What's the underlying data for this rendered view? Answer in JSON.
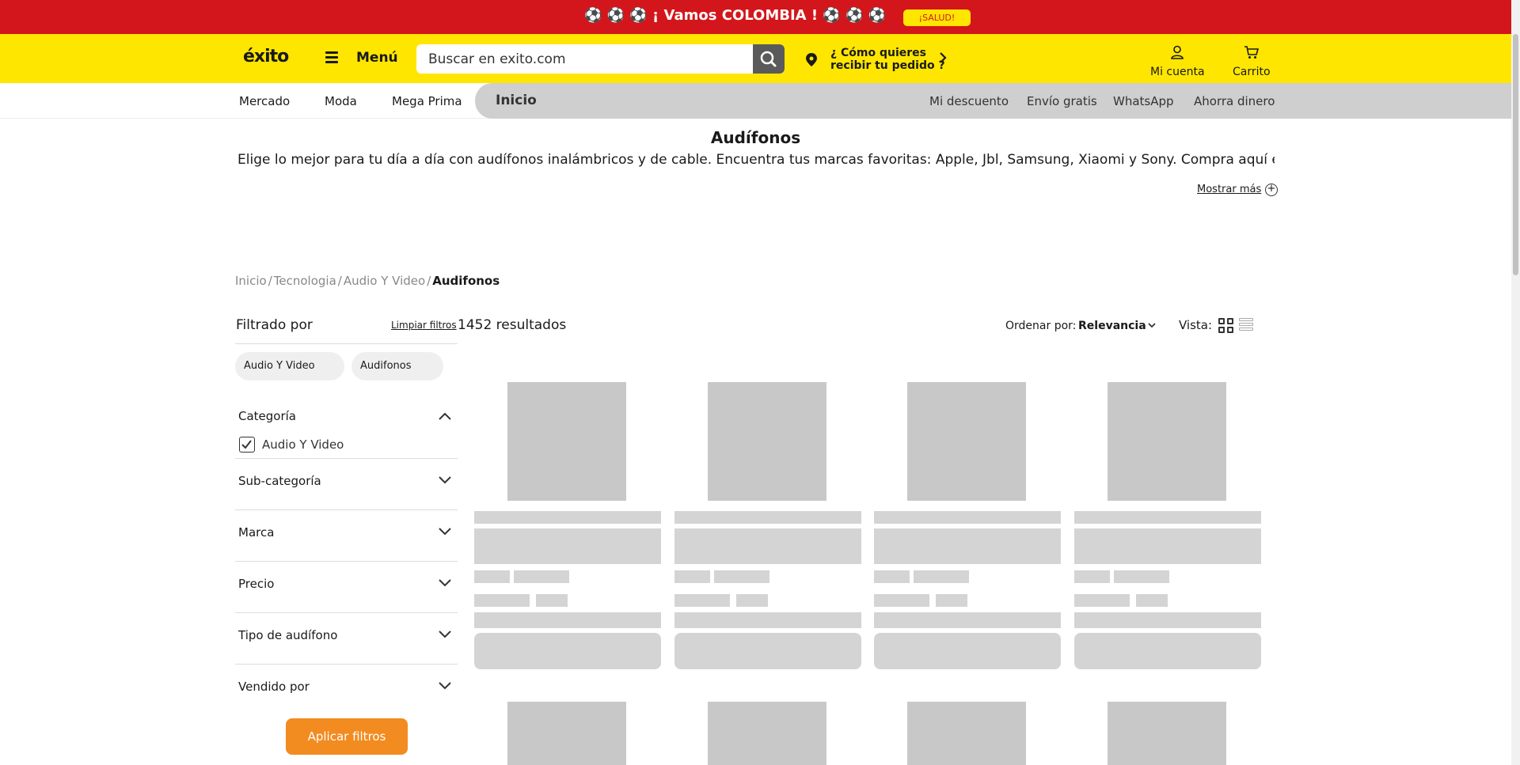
{
  "promo": {
    "text": "⚽ ⚽ ⚽ ¡ Vamos COLOMBIA ! ⚽ ⚽ ⚽",
    "button": "¡SALUD!"
  },
  "header": {
    "logo": "éxito",
    "menu_label": "Menú",
    "search_placeholder": "Buscar en exito.com",
    "location_line1": "¿ Cómo quieres",
    "location_line2": "recibir tu pedido ?",
    "account_label": "Mi cuenta",
    "cart_label": "Carrito"
  },
  "nav": {
    "left": [
      "Mercado",
      "Moda",
      "Mega Prima"
    ],
    "inicio": "Inicio",
    "right": [
      "Mi descuento",
      "Envío gratis",
      "WhatsApp",
      "Ahorra dinero"
    ]
  },
  "category": {
    "title": "Audífonos",
    "description": "Elige lo mejor para tu día a día con audífonos inalámbricos y de cable. Encuentra tus marcas favoritas: Apple, Jbl, Samsung, Xiaomi y Sony. Compra aquí en",
    "show_more": "Mostrar más"
  },
  "breadcrumb": [
    "Inicio",
    "Tecnologia",
    "Audio Y Video",
    "Audifonos"
  ],
  "sidebar": {
    "title": "Filtrado por",
    "clear": "Limpiar filtros",
    "chips": [
      "Audio Y Video",
      "Audifonos"
    ],
    "facets": [
      "Categoría",
      "Sub-categoría",
      "Marca",
      "Precio",
      "Tipo de audífono",
      "Vendido por"
    ],
    "category_option": "Audio Y Video",
    "apply": "Aplicar filtros"
  },
  "results": {
    "count": "1452 resultados",
    "sort_label": "Ordenar por:",
    "sort_value": "Relevancia",
    "view_label": "Vista:"
  },
  "colors": {
    "promo_red": "#d3161b",
    "brand_yellow": "#ffe600",
    "apply_orange": "#f28b20",
    "skeleton_gray": "#d4d4d4"
  }
}
